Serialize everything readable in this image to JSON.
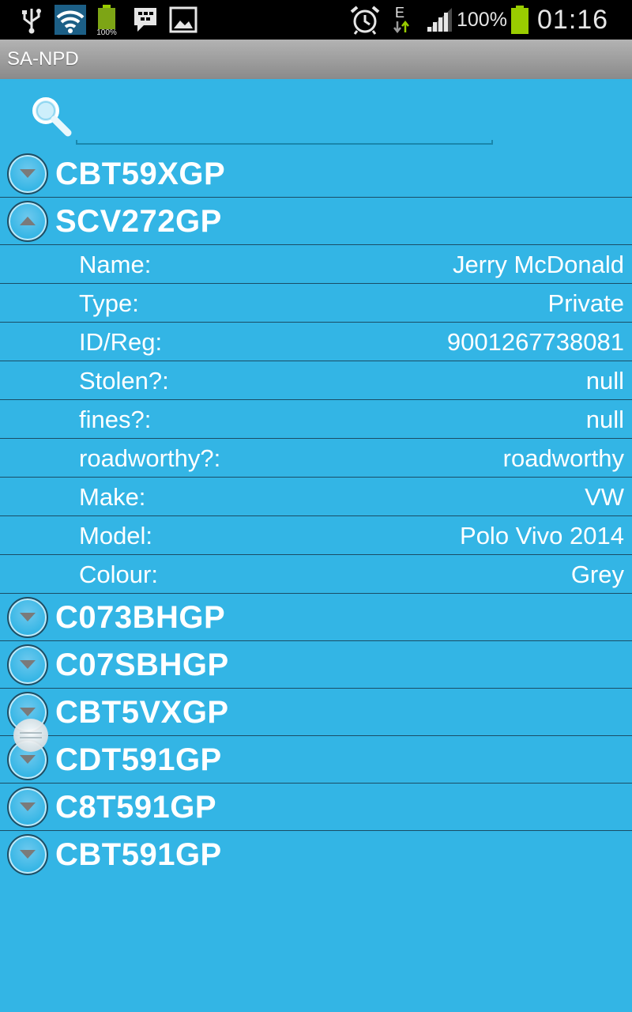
{
  "status_bar": {
    "battery_percent": "100%",
    "time": "01:16",
    "network_type": "E",
    "battery_small_label": "100%",
    "icons": [
      "usb-icon",
      "wifi-icon",
      "battery-icon",
      "bbm-icon",
      "gallery-icon",
      "alarm-icon",
      "data-transfer-icon",
      "signal-icon"
    ]
  },
  "app": {
    "title": "SA-NPD"
  },
  "search": {
    "value": ""
  },
  "groups": [
    {
      "plate": "CBT59XGP",
      "expanded": false
    },
    {
      "plate": "SCV272GP",
      "expanded": true
    },
    {
      "plate": "C073BHGP",
      "expanded": false
    },
    {
      "plate": "C07SBHGP",
      "expanded": false
    },
    {
      "plate": "CBT5VXGP",
      "expanded": false
    },
    {
      "plate": "CDT591GP",
      "expanded": false
    },
    {
      "plate": "C8T591GP",
      "expanded": false
    },
    {
      "plate": "CBT591GP",
      "expanded": false
    }
  ],
  "details": [
    {
      "label": "Name:",
      "value": "Jerry McDonald"
    },
    {
      "label": "Type:",
      "value": "Private"
    },
    {
      "label": "ID/Reg:",
      "value": "9001267738081"
    },
    {
      "label": "Stolen?:",
      "value": "null"
    },
    {
      "label": "fines?:",
      "value": "null"
    },
    {
      "label": "roadworthy?:",
      "value": "roadworthy"
    },
    {
      "label": "Make:",
      "value": "VW"
    },
    {
      "label": "Model:",
      "value": "Polo Vivo 2014"
    },
    {
      "label": "Colour:",
      "value": "Grey"
    }
  ],
  "colors": {
    "background": "#33b5e5",
    "divider": "#1a4d66",
    "battery": "#99cc00"
  }
}
